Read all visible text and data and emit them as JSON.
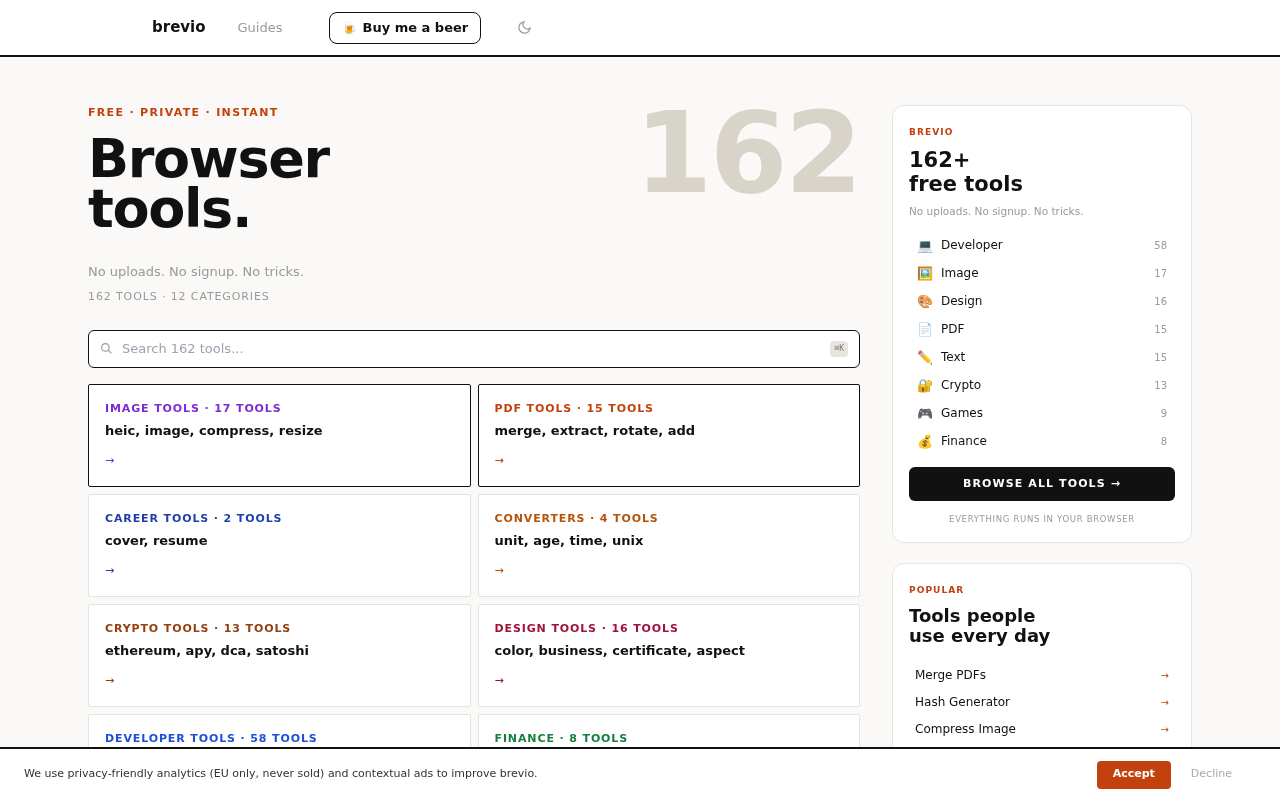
{
  "header": {
    "logo": "brevio",
    "nav": [
      {
        "label": "Guides"
      }
    ],
    "donate_button": {
      "icon": "🍺",
      "label": "Buy me a beer"
    }
  },
  "hero": {
    "eyebrow": "FREE · PRIVATE · INSTANT",
    "title_lines": [
      "Browser",
      "tools."
    ],
    "big_number": "162",
    "subtitle": "No uploads. No signup. No tricks.",
    "stats": "162 TOOLS · 12 CATEGORIES"
  },
  "search": {
    "placeholder": "Search 162 tools...",
    "shortcut": "⌘K"
  },
  "category_cards": [
    {
      "label": "IMAGE TOOLS · 17 TOOLS",
      "keywords": "heic, image, compress, resize",
      "arrow": "→",
      "color": "#7e2bd1",
      "highlighted": true
    },
    {
      "label": "PDF TOOLS · 15 TOOLS",
      "keywords": "merge, extract, rotate, add",
      "arrow": "→",
      "color": "#c2410c",
      "highlighted": true
    },
    {
      "label": "CAREER TOOLS · 2 TOOLS",
      "keywords": "cover, resume",
      "arrow": "→",
      "color": "#1e40af",
      "highlighted": false
    },
    {
      "label": "CONVERTERS · 4 TOOLS",
      "keywords": "unit, age, time, unix",
      "arrow": "→",
      "color": "#b45309",
      "highlighted": false
    },
    {
      "label": "CRYPTO TOOLS · 13 TOOLS",
      "keywords": "ethereum, apy, dca, satoshi",
      "arrow": "→",
      "color": "#92400e",
      "highlighted": false
    },
    {
      "label": "DESIGN TOOLS · 16 TOOLS",
      "keywords": "color, business, certificate, aspect",
      "arrow": "→",
      "color": "#9f1239",
      "highlighted": false
    },
    {
      "label": "DEVELOPER TOOLS · 58 TOOLS",
      "color": "#1d4ed8",
      "highlighted": false
    },
    {
      "label": "FINANCE · 8 TOOLS",
      "color": "#15803d",
      "highlighted": false
    }
  ],
  "summary_card": {
    "eyebrow": "BREVIO",
    "title_lines": [
      "162+",
      "free tools"
    ],
    "subtitle": "No uploads. No signup. No tricks.",
    "categories": [
      {
        "icon": "💻",
        "name": "Developer",
        "count": "58"
      },
      {
        "icon": "🖼️",
        "name": "Image",
        "count": "17"
      },
      {
        "icon": "🎨",
        "name": "Design",
        "count": "16"
      },
      {
        "icon": "📄",
        "name": "PDF",
        "count": "15"
      },
      {
        "icon": "✏️",
        "name": "Text",
        "count": "15"
      },
      {
        "icon": "🔐",
        "name": "Crypto",
        "count": "13"
      },
      {
        "icon": "🎮",
        "name": "Games",
        "count": "9"
      },
      {
        "icon": "💰",
        "name": "Finance",
        "count": "8"
      }
    ],
    "button": "BROWSE ALL TOOLS →",
    "footnote": "EVERYTHING RUNS IN YOUR BROWSER"
  },
  "popular_card": {
    "eyebrow": "POPULAR",
    "title_lines": [
      "Tools people",
      "use every day"
    ],
    "items": [
      {
        "name": "Merge PDFs",
        "arrow": "→"
      },
      {
        "name": "Hash Generator",
        "arrow": "→"
      },
      {
        "name": "Compress Image",
        "arrow": "→"
      }
    ]
  },
  "cookie_bar": {
    "text": "We use privacy-friendly analytics (EU only, never sold) and contextual ads to improve brevio.",
    "accept": "Accept",
    "decline": "Decline"
  }
}
